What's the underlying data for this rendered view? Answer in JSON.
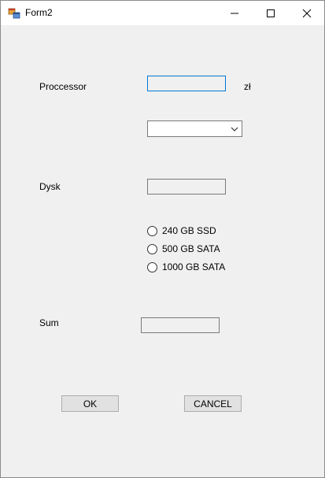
{
  "window": {
    "title": "Form2"
  },
  "form": {
    "processor": {
      "label": "Proccessor",
      "value": "",
      "unit": "zł"
    },
    "processor_combo": {
      "selected": ""
    },
    "disk": {
      "label": "Dysk",
      "value": ""
    },
    "disk_options": [
      {
        "label": "240 GB SSD",
        "checked": false
      },
      {
        "label": "500 GB SATA",
        "checked": false
      },
      {
        "label": "1000 GB SATA",
        "checked": false
      }
    ],
    "sum": {
      "label": "Sum",
      "value": ""
    },
    "ok_label": "OK",
    "cancel_label": "CANCEL"
  }
}
